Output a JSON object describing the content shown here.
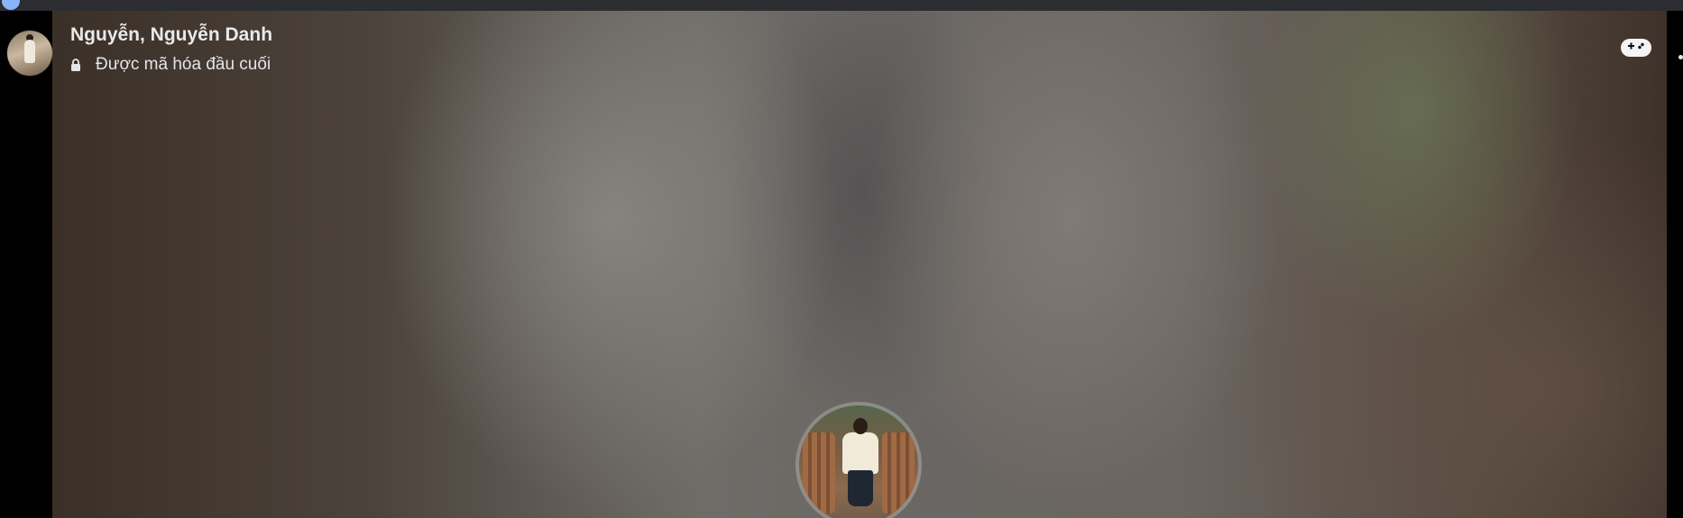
{
  "window": {
    "accent_color": "#8ab4f8"
  },
  "call": {
    "participant_name": "Nguyễn, Nguyễn Danh",
    "encryption_status": "Được mã hóa đầu cuối",
    "icons": {
      "lock": "lock-icon",
      "game": "game-controller-icon",
      "more": "more-options-icon"
    }
  }
}
